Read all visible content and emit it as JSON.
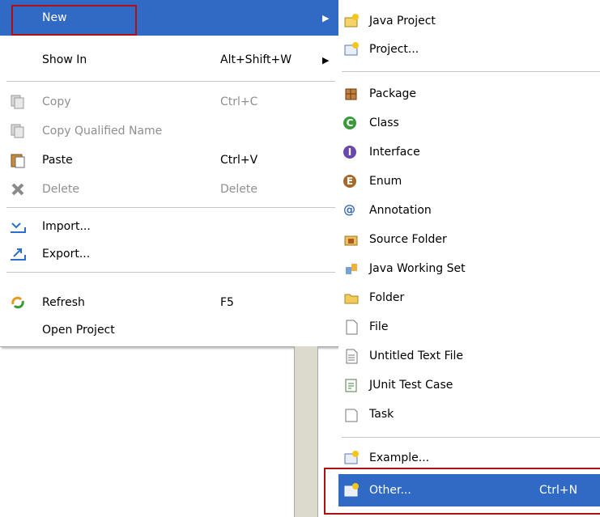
{
  "main_menu": {
    "items": [
      {
        "label": "New",
        "accel": "",
        "submenu": true,
        "enabled": true,
        "highlighted": true
      },
      {
        "label": "Show In",
        "accel": "Alt+Shift+W",
        "submenu": true,
        "enabled": true
      },
      {
        "label": "Copy",
        "accel": "Ctrl+C",
        "enabled": false
      },
      {
        "label": "Copy Qualified Name",
        "accel": "",
        "enabled": false
      },
      {
        "label": "Paste",
        "accel": "Ctrl+V",
        "enabled": true
      },
      {
        "label": "Delete",
        "accel": "Delete",
        "enabled": false
      },
      {
        "label": "Import...",
        "accel": "",
        "enabled": true
      },
      {
        "label": "Export...",
        "accel": "",
        "enabled": true
      },
      {
        "label": "Refresh",
        "accel": "F5",
        "enabled": true
      },
      {
        "label": "Open Project",
        "accel": "",
        "enabled": true
      }
    ]
  },
  "sub_menu": {
    "items": [
      {
        "label": "Java Project",
        "icon": "java-project-icon"
      },
      {
        "label": "Project...",
        "icon": "project-icon"
      },
      {
        "label": "Package",
        "icon": "package-icon"
      },
      {
        "label": "Class",
        "icon": "class-icon"
      },
      {
        "label": "Interface",
        "icon": "interface-icon"
      },
      {
        "label": "Enum",
        "icon": "enum-icon"
      },
      {
        "label": "Annotation",
        "icon": "annotation-icon"
      },
      {
        "label": "Source Folder",
        "icon": "source-folder-icon"
      },
      {
        "label": "Java Working Set",
        "icon": "working-set-icon"
      },
      {
        "label": "Folder",
        "icon": "folder-icon"
      },
      {
        "label": "File",
        "icon": "file-icon"
      },
      {
        "label": "Untitled Text File",
        "icon": "text-file-icon"
      },
      {
        "label": "JUnit Test Case",
        "icon": "junit-icon"
      },
      {
        "label": "Task",
        "icon": "task-icon"
      },
      {
        "label": "Example...",
        "icon": "example-icon"
      },
      {
        "label": "Other...",
        "accel": "Ctrl+N",
        "icon": "other-wizard-icon",
        "highlighted": true
      }
    ]
  },
  "colors": {
    "highlight": "#316ac5",
    "annotation_box": "#b01010",
    "disabled_text": "#8f8f8f"
  }
}
